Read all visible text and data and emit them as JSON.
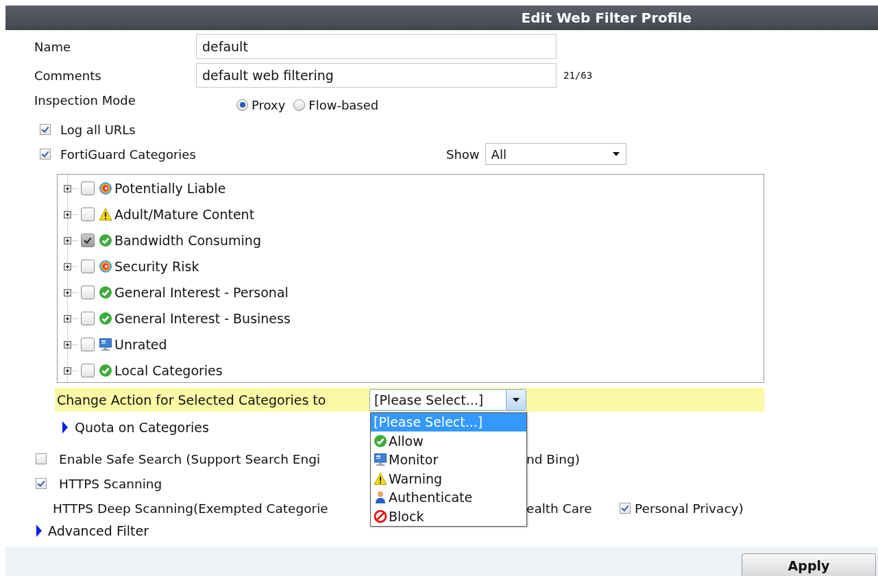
{
  "title": "Edit Web Filter Profile",
  "name": {
    "label": "Name",
    "value": "default"
  },
  "comments": {
    "label": "Comments",
    "value": "default web filtering",
    "counter": "21/63"
  },
  "inspection_mode": {
    "label": "Inspection Mode",
    "options": [
      {
        "label": "Proxy",
        "selected": true
      },
      {
        "label": "Flow-based",
        "selected": false
      }
    ]
  },
  "log_all_urls": {
    "label": "Log all URLs",
    "checked": true
  },
  "fortiguard": {
    "label": "FortiGuard Categories",
    "checked": true,
    "show_label": "Show",
    "show_value": "All"
  },
  "categories": [
    {
      "label": "Potentially Liable",
      "checked": false,
      "expanded": false,
      "kind": "mixed"
    },
    {
      "label": "Adult/Mature Content",
      "checked": false,
      "expanded": false,
      "kind": "warning"
    },
    {
      "label": "Bandwidth Consuming",
      "checked": true,
      "expanded": false,
      "kind": "allow"
    },
    {
      "label": "Security Risk",
      "checked": false,
      "expanded": false,
      "kind": "mixed"
    },
    {
      "label": "General Interest - Personal",
      "checked": false,
      "expanded": false,
      "kind": "allow"
    },
    {
      "label": "General Interest - Business",
      "checked": false,
      "expanded": false,
      "kind": "allow"
    },
    {
      "label": "Unrated",
      "checked": false,
      "expanded": false,
      "kind": "monitor"
    },
    {
      "label": "Local Categories",
      "checked": false,
      "expanded": false,
      "kind": "allow"
    }
  ],
  "change_action": {
    "label": "Change Action for Selected Categories to",
    "value": "[Please Select...]"
  },
  "action_menu": [
    {
      "label": "[Please Select...]",
      "selected": true,
      "kind": "none"
    },
    {
      "label": "Allow",
      "selected": false,
      "kind": "allow"
    },
    {
      "label": "Monitor",
      "selected": false,
      "kind": "monitor"
    },
    {
      "label": "Warning",
      "selected": false,
      "kind": "warning"
    },
    {
      "label": "Authenticate",
      "selected": false,
      "kind": "authenticate"
    },
    {
      "label": "Block",
      "selected": false,
      "kind": "block"
    }
  ],
  "quota": {
    "label": "Quota on Categories",
    "expanded": false
  },
  "safe_search": {
    "checked": false,
    "label_start": "Enable Safe Search (Support Search Engi",
    "label_end": "nd Bing)"
  },
  "https_scanning": {
    "label": "HTTPS Scanning",
    "checked": true
  },
  "deep_scanning": {
    "label_start": "HTTPS Deep Scanning(Exempted Categorie",
    "label_middle": "ealth Care",
    "exemption": {
      "label": "Personal Privacy)",
      "checked": true
    }
  },
  "advanced_filter": {
    "label": "Advanced Filter",
    "expanded": false
  },
  "apply": "Apply"
}
